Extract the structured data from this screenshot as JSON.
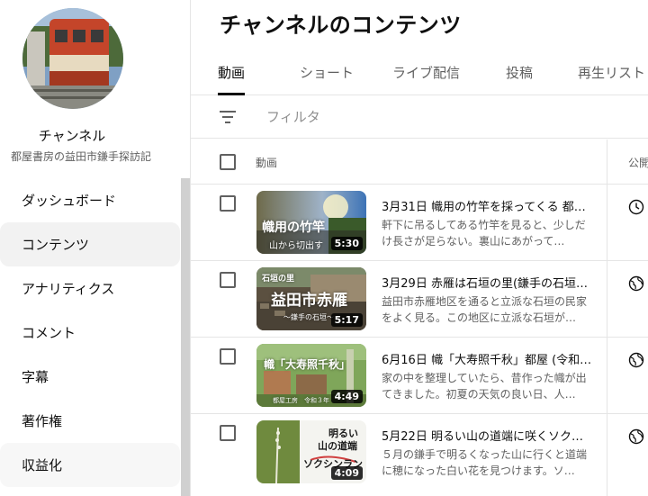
{
  "sidebar": {
    "channel_name": "チャンネル",
    "channel_subtitle": "都屋書房の益田市鎌手探訪記",
    "avatar_icon": "train-photo-avatar",
    "items": [
      {
        "label": "ダッシュボード",
        "icon": "dashboard-icon"
      },
      {
        "label": "コンテンツ",
        "icon": "content-icon",
        "active": true
      },
      {
        "label": "アナリティクス",
        "icon": "analytics-icon"
      },
      {
        "label": "コメント",
        "icon": "comments-icon"
      },
      {
        "label": "字幕",
        "icon": "subtitles-icon"
      },
      {
        "label": "著作権",
        "icon": "copyright-icon"
      },
      {
        "label": "収益化",
        "icon": "monetization-icon"
      }
    ]
  },
  "main": {
    "title": "チャンネルのコンテンツ",
    "tabs": [
      {
        "label": "動画",
        "active": true
      },
      {
        "label": "ショート"
      },
      {
        "label": "ライブ配信"
      },
      {
        "label": "投稿"
      },
      {
        "label": "再生リスト"
      }
    ],
    "filter": {
      "placeholder": "フィルタ",
      "icon": "filter-icon"
    },
    "table": {
      "columns": {
        "video": "動画",
        "visibility": "公開"
      },
      "rows": [
        {
          "title": "3月31日 幟用の竹竿を採ってくる 都…",
          "description": "軒下に吊るしてある竹竿を見ると、少しだけ長さが足らない。裏山にあがって…",
          "duration": "5:30",
          "thumb_text_main": "幟用の竹竿",
          "thumb_text_sub": "山から切出す",
          "visibility_icon": "clock-icon"
        },
        {
          "title": "3月29日 赤雁は石垣の里(鎌手の石垣7…",
          "description": "益田市赤雁地区を通ると立派な石垣の民家をよく見る。この地区に立派な石垣が…",
          "duration": "5:17",
          "thumb_text_top": "石垣の里",
          "thumb_text_main": "益田市赤雁",
          "thumb_text_sub": "～鎌手の石垣～",
          "visibility_icon": "globe-icon"
        },
        {
          "title": "6月16日 幟「大寿照千秋」都屋 (令和…",
          "description": "家の中を整理していたら、昔作った幟が出てきました。初夏の天気の良い日、人…",
          "duration": "4:49",
          "thumb_text_main": "幟「大寿照千秋」",
          "thumb_text_sub": "都屋工房　令和３年",
          "visibility_icon": "globe-icon"
        },
        {
          "title": "5月22日 明るい山の道端に咲くソクシ…",
          "description": "５月の鎌手で明るくなった山に行くと道端に穂になった白い花を見つけます。ソ…",
          "duration": "4:09",
          "thumb_text_main": "明るい",
          "thumb_text_main2": "山の道端",
          "thumb_text_sub": "ソクシンラン",
          "visibility_icon": "globe-icon"
        }
      ]
    }
  }
}
